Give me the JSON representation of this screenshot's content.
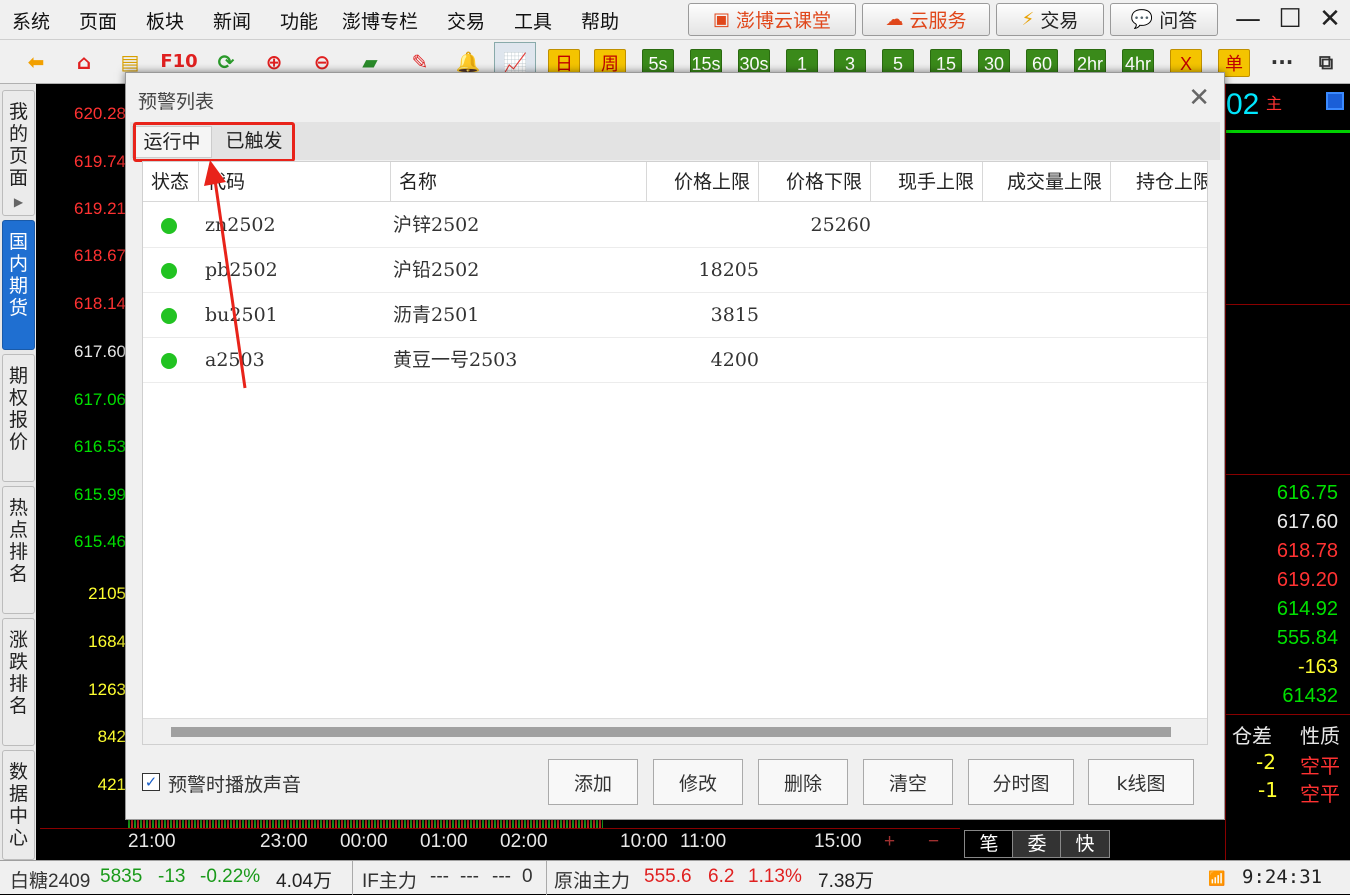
{
  "menu": [
    "系统",
    "页面",
    "板块",
    "新闻",
    "功能",
    "澎博专栏",
    "交易",
    "工具",
    "帮助"
  ],
  "top_buttons": {
    "cloud_class": "澎博云课堂",
    "cloud_service": "云服务",
    "trade": "交易",
    "qa": "问答"
  },
  "window_controls": {
    "minimize": "—",
    "maximize": "☐",
    "close": "✕"
  },
  "toolbar": {
    "f10": "F10",
    "day": "日",
    "week": "周",
    "periods": [
      "5s",
      "15s",
      "30s",
      "1",
      "3",
      "5",
      "15",
      "30",
      "60",
      "2hr",
      "4hr"
    ],
    "x": "X",
    "single": "单",
    "more": "···"
  },
  "side_tabs": [
    "我的页面",
    "国内期货",
    "期权报价",
    "热点排名",
    "涨跌排名",
    "数据中心"
  ],
  "price_axis": [
    {
      "v": "620.28",
      "c": "red"
    },
    {
      "v": "619.74",
      "c": "red"
    },
    {
      "v": "619.21",
      "c": "red"
    },
    {
      "v": "618.67",
      "c": "red"
    },
    {
      "v": "618.14",
      "c": "red"
    },
    {
      "v": "617.60",
      "c": "wht"
    },
    {
      "v": "617.06",
      "c": "grn"
    },
    {
      "v": "616.53",
      "c": "grn"
    },
    {
      "v": "615.99",
      "c": "grn"
    },
    {
      "v": "615.46",
      "c": "grn"
    }
  ],
  "volume_axis": [
    "2105",
    "1684",
    "1263",
    "842",
    "421"
  ],
  "right_panel": {
    "code_suffix": "02",
    "main_mark": "主",
    "values": [
      {
        "v": "616.75",
        "c": "grn"
      },
      {
        "v": "617.60",
        "c": "wht"
      },
      {
        "v": "618.78",
        "c": "red"
      },
      {
        "v": "619.20",
        "c": "red"
      },
      {
        "v": "614.92",
        "c": "grn"
      },
      {
        "v": "555.84",
        "c": "grn"
      },
      {
        "v": "-163",
        "c": "yel"
      },
      {
        "v": "61432",
        "c": "grn"
      }
    ],
    "col_headers": [
      "仓差",
      "性质"
    ],
    "rows": [
      {
        "diff": "-2",
        "nature": "空平"
      },
      {
        "diff": "-1",
        "nature": "空平"
      }
    ]
  },
  "time_axis": [
    "21:00",
    "23:00",
    "00:00",
    "01:00",
    "02:00",
    "10:00",
    "11:00",
    "15:00"
  ],
  "time_controls": {
    "plus": "+",
    "minus": "−",
    "tabs": [
      "笔",
      "委",
      "快"
    ]
  },
  "status": {
    "sugar": {
      "name": "白糖2409",
      "price": "5835",
      "change": "-13",
      "pct": "-0.22%",
      "vol": "4.04万"
    },
    "if": {
      "name": "IF主力",
      "v1": "---",
      "v2": "---",
      "v3": "---",
      "v4": "0"
    },
    "oil": {
      "name": "原油主力",
      "price": "555.6",
      "change": "6.2",
      "pct": "1.13%",
      "vol": "7.38万"
    },
    "time": "9:24:31"
  },
  "dialog": {
    "title": "预警列表",
    "tabs": [
      "运行中",
      "已触发"
    ],
    "columns": [
      "状态",
      "代码",
      "名称",
      "价格上限",
      "价格下限",
      "现手上限",
      "成交量上限",
      "持仓上限"
    ],
    "rows": [
      {
        "code": "zn2502",
        "name": "沪锌2502",
        "upper": "",
        "lower": "25260"
      },
      {
        "code": "pb2502",
        "name": "沪铅2502",
        "upper": "18205",
        "lower": ""
      },
      {
        "code": "bu2501",
        "name": "沥青2501",
        "upper": "3815",
        "lower": ""
      },
      {
        "code": "a2503",
        "name": "黄豆一号2503",
        "upper": "4200",
        "lower": ""
      }
    ],
    "sound_checkbox": "预警时播放声音",
    "buttons": {
      "add": "添加",
      "modify": "修改",
      "delete": "删除",
      "clear": "清空",
      "timechart": "分时图",
      "kline": "k线图"
    }
  },
  "colors": {
    "highlight": "#e8231a",
    "active_tab": "#1f6fd1",
    "status_dot": "#22c322"
  }
}
